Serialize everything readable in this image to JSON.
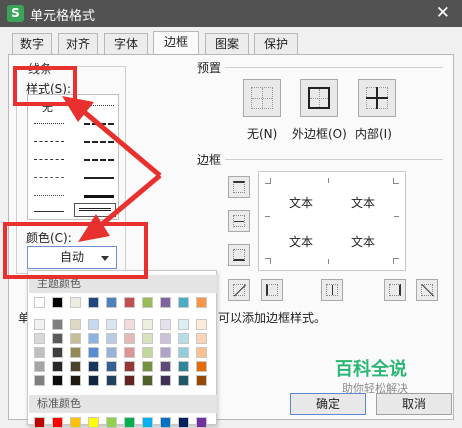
{
  "window": {
    "title": "单元格格式",
    "logo": "S",
    "close": "✕"
  },
  "tabs": [
    "数字",
    "对齐",
    "字体",
    "边框",
    "图案",
    "保护"
  ],
  "active_tab": "边框",
  "line_group": {
    "title": "线条",
    "style_label": "样式(S):",
    "none_label": "无",
    "color_label": "颜色(C):",
    "color_value": "自动"
  },
  "presets": {
    "title": "预置",
    "none": "无(N)",
    "outline": "外边框(O)",
    "inside": "内部(I)"
  },
  "border": {
    "title": "边框",
    "preview_text": [
      "文本",
      "文本",
      "文本",
      "文本"
    ]
  },
  "hint_text": "单",
  "hint_text_tail": "可以添加边框样式。",
  "buttons": {
    "ok": "确定",
    "cancel": "取消"
  },
  "color_popup": {
    "theme_label": "主题颜色",
    "standard_label": "标准颜色",
    "theme_top": [
      "#ffffff",
      "#000000",
      "#eeece1",
      "#1f497d",
      "#4f81bd",
      "#c0504d",
      "#9bbb59",
      "#8064a2",
      "#4bacc6",
      "#f79646"
    ],
    "theme_shades": [
      [
        "#f2f2f2",
        "#7f7f7f",
        "#ddd9c3",
        "#c6d9f0",
        "#dbe5f1",
        "#f2dcdb",
        "#ebf1dd",
        "#e5e0ec",
        "#dbeef3",
        "#fdeada"
      ],
      [
        "#d8d8d8",
        "#595959",
        "#c4bd97",
        "#8db3e2",
        "#b8cce4",
        "#e5b9b7",
        "#d7e3bc",
        "#ccc1d9",
        "#b7dde8",
        "#fbd5b5"
      ],
      [
        "#bfbfbf",
        "#3f3f3f",
        "#938953",
        "#548dd4",
        "#95b3d7",
        "#d99694",
        "#c3d69b",
        "#b2a2c7",
        "#92cddc",
        "#fac08f"
      ],
      [
        "#a5a5a5",
        "#262626",
        "#494429",
        "#17365d",
        "#366092",
        "#953734",
        "#76923c",
        "#5f497a",
        "#31859b",
        "#e36c09"
      ],
      [
        "#7f7f7f",
        "#0c0c0c",
        "#1d1b10",
        "#0f243e",
        "#244061",
        "#632423",
        "#4f6128",
        "#3f3151",
        "#205867",
        "#974806"
      ]
    ],
    "standard": [
      "#c00000",
      "#ff0000",
      "#ffc000",
      "#ffff00",
      "#92d050",
      "#00b050",
      "#00b0f0",
      "#0070c0",
      "#002060",
      "#7030a0"
    ]
  },
  "watermark": {
    "brand": "百科全说",
    "sub": "助你轻松解决"
  },
  "accent_red": "#e8312f"
}
